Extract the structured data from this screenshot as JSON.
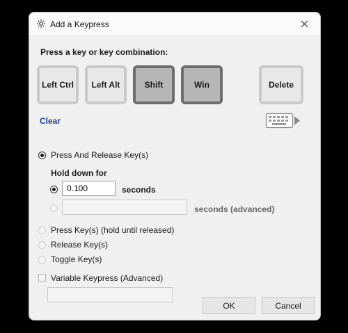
{
  "window": {
    "title": "Add a Keypress"
  },
  "prompt": "Press a key or key combination:",
  "keys": [
    {
      "label": "Left Ctrl"
    },
    {
      "label": "Left Alt"
    },
    {
      "label": "Shift"
    },
    {
      "label": "Win"
    },
    {
      "label": "Delete"
    }
  ],
  "clear_label": "Clear",
  "options": {
    "press_release": "Press And Release Key(s)",
    "hold_down_for": "Hold down for",
    "hold_value": "0.100",
    "seconds": "seconds",
    "advanced_value": "",
    "seconds_advanced": "seconds (advanced)",
    "press_hold": "Press Key(s) (hold until released)",
    "release": "Release Key(s)",
    "toggle": "Toggle Key(s)",
    "variable": "Variable Keypress (Advanced)",
    "variable_value": ""
  },
  "buttons": {
    "ok": "OK",
    "cancel": "Cancel"
  }
}
